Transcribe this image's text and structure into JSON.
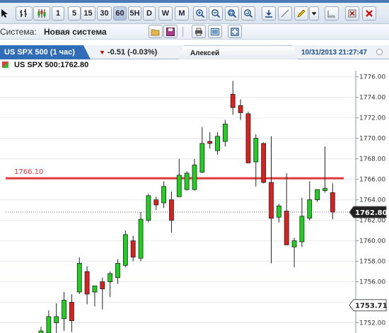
{
  "toolbar": {
    "period_buttons": [
      "1",
      "5",
      "15",
      "30",
      "60",
      "5H",
      "D",
      "W",
      "M"
    ],
    "active_period": "60"
  },
  "system_bar": {
    "label": "Системa:",
    "value": "Новая система"
  },
  "tab": {
    "title": "US SPX 500 (1 час)",
    "change": "-0.51 (-0.03%)",
    "user": "Алексей",
    "datetime": "10/31/2013 21:27:47"
  },
  "info": {
    "symbol_price": "US SPX 500:1762.80"
  },
  "colors": {
    "bull": "#1fd11f",
    "bear": "#dd1f1f",
    "resistance": "#e03b3b",
    "accent": "#2f6db8"
  },
  "chart_data": {
    "type": "candlestick",
    "ylim": [
      1751.0,
      1776.6
    ],
    "y_ticks": [
      "1776.00",
      "1774.00",
      "1772.00",
      "1770.00",
      "1768.00",
      "1766.00",
      "1764.00",
      "1762.00",
      "1760.00",
      "1758.00",
      "1756.00",
      "1754.00",
      "1752.00"
    ],
    "horizontal_line": {
      "label": "1766.10",
      "value": 1766.1
    },
    "current_price": {
      "label": "1762.80",
      "value": 1762.8
    },
    "low_marker": {
      "label": "1753.71",
      "value": 1753.71
    },
    "candles": [
      {
        "o": 1750.5,
        "h": 1751.6,
        "l": 1750.3,
        "c": 1751.2
      },
      {
        "o": 1751.0,
        "h": 1753.2,
        "l": 1750.4,
        "c": 1752.6
      },
      {
        "o": 1752.0,
        "h": 1753.9,
        "l": 1751.0,
        "c": 1752.6
      },
      {
        "o": 1752.4,
        "h": 1755.0,
        "l": 1751.2,
        "c": 1754.2
      },
      {
        "o": 1754.0,
        "h": 1754.8,
        "l": 1751.1,
        "c": 1752.2
      },
      {
        "o": 1755.0,
        "h": 1758.4,
        "l": 1754.8,
        "c": 1757.8
      },
      {
        "o": 1757.0,
        "h": 1757.5,
        "l": 1753.8,
        "c": 1754.8
      },
      {
        "o": 1755.0,
        "h": 1755.5,
        "l": 1753.6,
        "c": 1755.6
      },
      {
        "o": 1756.0,
        "h": 1756.4,
        "l": 1753.3,
        "c": 1755.3
      },
      {
        "o": 1756.0,
        "h": 1757.0,
        "l": 1754.5,
        "c": 1756.8
      },
      {
        "o": 1756.4,
        "h": 1758.2,
        "l": 1755.8,
        "c": 1757.8
      },
      {
        "o": 1757.6,
        "h": 1761.0,
        "l": 1757.4,
        "c": 1760.6
      },
      {
        "o": 1760.0,
        "h": 1760.5,
        "l": 1758.0,
        "c": 1758.4
      },
      {
        "o": 1758.3,
        "h": 1762.8,
        "l": 1758.0,
        "c": 1762.1
      },
      {
        "o": 1762.0,
        "h": 1764.6,
        "l": 1761.8,
        "c": 1764.4
      },
      {
        "o": 1764.0,
        "h": 1764.3,
        "l": 1763.0,
        "c": 1763.5
      },
      {
        "o": 1763.7,
        "h": 1765.8,
        "l": 1763.2,
        "c": 1765.3
      },
      {
        "o": 1764.0,
        "h": 1764.8,
        "l": 1760.8,
        "c": 1762.0
      },
      {
        "o": 1764.3,
        "h": 1768.0,
        "l": 1765.0,
        "c": 1766.4
      },
      {
        "o": 1765.0,
        "h": 1766.8,
        "l": 1764.9,
        "c": 1766.6
      },
      {
        "o": 1765.0,
        "h": 1768.0,
        "l": 1764.9,
        "c": 1767.4
      },
      {
        "o": 1766.7,
        "h": 1771.1,
        "l": 1766.6,
        "c": 1769.5
      },
      {
        "o": 1769.7,
        "h": 1770.6,
        "l": 1769.0,
        "c": 1769.5
      },
      {
        "o": 1768.8,
        "h": 1770.6,
        "l": 1768.4,
        "c": 1770.2
      },
      {
        "o": 1769.7,
        "h": 1771.8,
        "l": 1769.2,
        "c": 1771.4
      },
      {
        "o": 1774.3,
        "h": 1775.6,
        "l": 1772.3,
        "c": 1773.0
      },
      {
        "o": 1773.2,
        "h": 1773.8,
        "l": 1771.8,
        "c": 1772.5
      },
      {
        "o": 1772.4,
        "h": 1772.6,
        "l": 1767.6,
        "c": 1767.6
      },
      {
        "o": 1767.7,
        "h": 1770.4,
        "l": 1765.3,
        "c": 1770.0
      },
      {
        "o": 1769.5,
        "h": 1769.6,
        "l": 1765.6,
        "c": 1765.7
      },
      {
        "o": 1765.7,
        "h": 1770.2,
        "l": 1757.8,
        "c": 1762.2
      },
      {
        "o": 1762.3,
        "h": 1763.6,
        "l": 1761.8,
        "c": 1763.4
      },
      {
        "o": 1762.9,
        "h": 1766.6,
        "l": 1759.6,
        "c": 1759.6
      },
      {
        "o": 1759.4,
        "h": 1760.3,
        "l": 1757.4,
        "c": 1760.0
      },
      {
        "o": 1759.9,
        "h": 1764.2,
        "l": 1759.4,
        "c": 1762.4
      },
      {
        "o": 1762.2,
        "h": 1765.8,
        "l": 1762.0,
        "c": 1764.0
      },
      {
        "o": 1764.0,
        "h": 1765.0,
        "l": 1763.8,
        "c": 1765.0
      },
      {
        "o": 1764.9,
        "h": 1769.2,
        "l": 1764.7,
        "c": 1765.1
      },
      {
        "o": 1764.7,
        "h": 1765.6,
        "l": 1762.1,
        "c": 1762.8
      }
    ]
  }
}
